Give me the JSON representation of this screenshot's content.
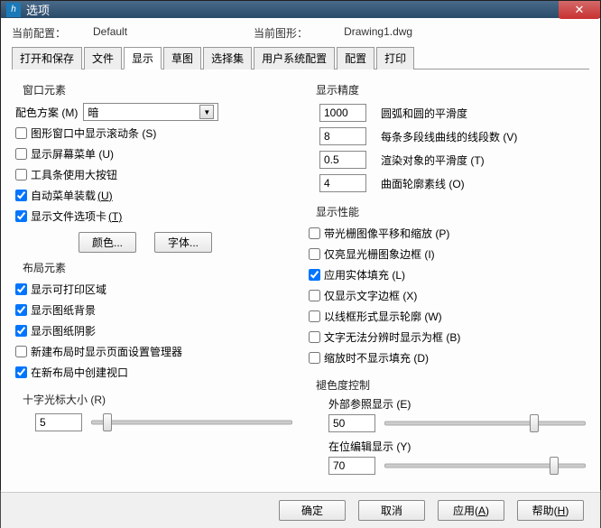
{
  "window": {
    "title": "选项"
  },
  "info": {
    "current_config_label": "当前配置：",
    "current_config_value": "Default",
    "current_drawing_label": "当前图形：",
    "current_drawing_value": "Drawing1.dwg"
  },
  "tabs": {
    "open_save": "打开和保存",
    "file": "文件",
    "display": "显示",
    "sketch": "草图",
    "selection": "选择集",
    "user_config": "用户系统配置",
    "config": "配置",
    "print": "打印"
  },
  "left": {
    "window_elements": "窗口元素",
    "color_scheme_label": "配色方案 (M)",
    "color_scheme_value": "暗",
    "scrollbars": "图形窗口中显示滚动条 (S)",
    "screen_menu": "显示屏幕菜单 (U)",
    "big_buttons": "工具条使用大按钮",
    "auto_menu": "自动菜单装载",
    "auto_menu_key": "(U)",
    "file_tabs": "显示文件选项卡",
    "file_tabs_key": "(T)",
    "color_btn": "颜色...",
    "font_btn": "字体...",
    "layout_elements": "布局元素",
    "printable_area": "显示可打印区域",
    "paper_bg": "显示图纸背景",
    "paper_shadow": "显示图纸阴影",
    "page_setup_mgr": "新建布局时显示页面设置管理器",
    "create_viewport": "在新布局中创建视口",
    "crosshair_size": "十字光标大小 (R)",
    "crosshair_value": "5"
  },
  "right": {
    "display_precision": "显示精度",
    "arc_smooth_val": "1000",
    "arc_smooth": "圆弧和圆的平滑度",
    "polyline_val": "8",
    "polyline": "每条多段线曲线的线段数 (V)",
    "render_smooth_val": "0.5",
    "render_smooth": "渲染对象的平滑度 (T)",
    "surface_val": "4",
    "surface": "曲面轮廓素线 (O)",
    "display_perf": "显示性能",
    "raster_pan": "带光栅图像平移和缩放 (P)",
    "raster_frame": "仅亮显光栅图象边框 (I)",
    "solid_fill": "应用实体填充 (L)",
    "text_frame": "仅显示文字边框 (X)",
    "wireframe": "以线框形式显示轮廓 (W)",
    "text_box": "文字无法分辨时显示为框 (B)",
    "no_fill_zoom": "缩放时不显示填充 (D)",
    "fade_control": "褪色度控制",
    "xref_display": "外部参照显示 (E)",
    "xref_val": "50",
    "inplace_edit": "在位编辑显示 (Y)",
    "inplace_val": "70"
  },
  "footer": {
    "ok": "确定",
    "cancel": "取消",
    "apply": "应用(A)",
    "help": "帮助(H)"
  }
}
